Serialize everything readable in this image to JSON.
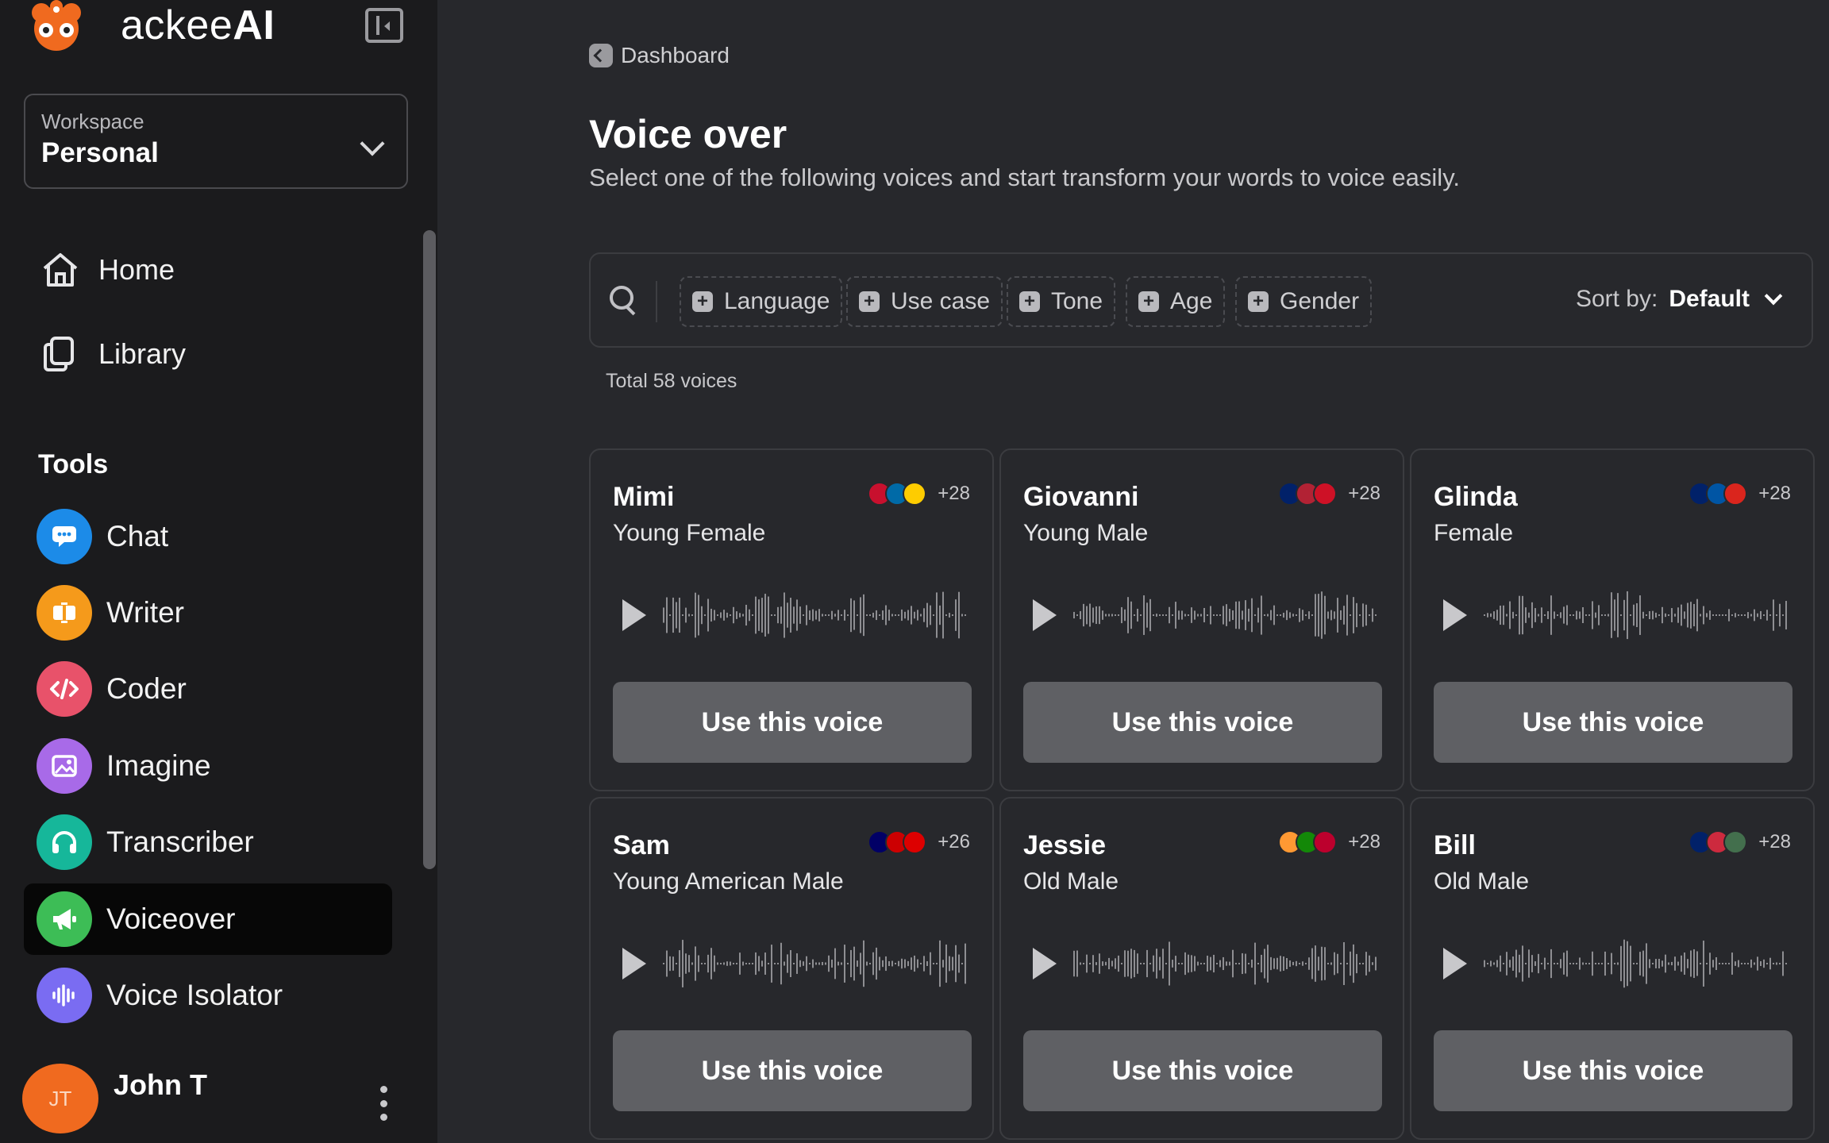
{
  "brand": {
    "name_light": "ackee",
    "name_bold": "AI"
  },
  "workspace": {
    "label": "Workspace",
    "value": "Personal"
  },
  "nav": [
    {
      "label": "Home",
      "icon": "home-icon"
    },
    {
      "label": "Library",
      "icon": "library-icon"
    }
  ],
  "tools_title": "Tools",
  "tools": [
    {
      "label": "Chat",
      "icon": "chat-icon",
      "color": "#1c8be8",
      "active": false
    },
    {
      "label": "Writer",
      "icon": "writer-icon",
      "color": "#f59a1b",
      "active": false
    },
    {
      "label": "Coder",
      "icon": "coder-icon",
      "color": "#e8526a",
      "active": false
    },
    {
      "label": "Imagine",
      "icon": "imagine-icon",
      "color": "#a86ae8",
      "active": false
    },
    {
      "label": "Transcriber",
      "icon": "headphones-icon",
      "color": "#16b79a",
      "active": false
    },
    {
      "label": "Voiceover",
      "icon": "megaphone-icon",
      "color": "#3dbd56",
      "active": true
    },
    {
      "label": "Voice Isolator",
      "icon": "soundwave-icon",
      "color": "#7a6cf2",
      "active": false
    }
  ],
  "user": {
    "initials": "JT",
    "name": "John T"
  },
  "breadcrumb": "Dashboard",
  "page": {
    "title": "Voice over",
    "subtitle": "Select one of the following voices and start transform your words to voice easily."
  },
  "filters": [
    "Language",
    "Use case",
    "Tone",
    "Age",
    "Gender"
  ],
  "sort": {
    "label": "Sort by:",
    "value": "Default"
  },
  "total": "Total 58 voices",
  "voices": [
    {
      "name": "Mimi",
      "desc": "Young Female",
      "flag_count": "+28",
      "flags": [
        "#c8102e",
        "#006aa7",
        "#fecc00"
      ],
      "button": "Use this voice"
    },
    {
      "name": "Giovanni",
      "desc": "Young Male",
      "flag_count": "+28",
      "flags": [
        "#012169",
        "#b22234",
        "#ce1126"
      ],
      "button": "Use this voice"
    },
    {
      "name": "Glinda",
      "desc": "Female",
      "flag_count": "+28",
      "flags": [
        "#012169",
        "#0055a4",
        "#da251d"
      ],
      "button": "Use this voice"
    },
    {
      "name": "Sam",
      "desc": "Young American Male",
      "flag_count": "+26",
      "flags": [
        "#010066",
        "#cc0001",
        "#dd0000"
      ],
      "button": "Use this voice"
    },
    {
      "name": "Jessie",
      "desc": "Old Male",
      "flag_count": "+28",
      "flags": [
        "#ff9933",
        "#138808",
        "#bc002d"
      ],
      "button": "Use this voice"
    },
    {
      "name": "Bill",
      "desc": "Old Male",
      "flag_count": "+28",
      "flags": [
        "#012169",
        "#cd2a3e",
        "#436f4d"
      ],
      "button": "Use this voice"
    }
  ]
}
